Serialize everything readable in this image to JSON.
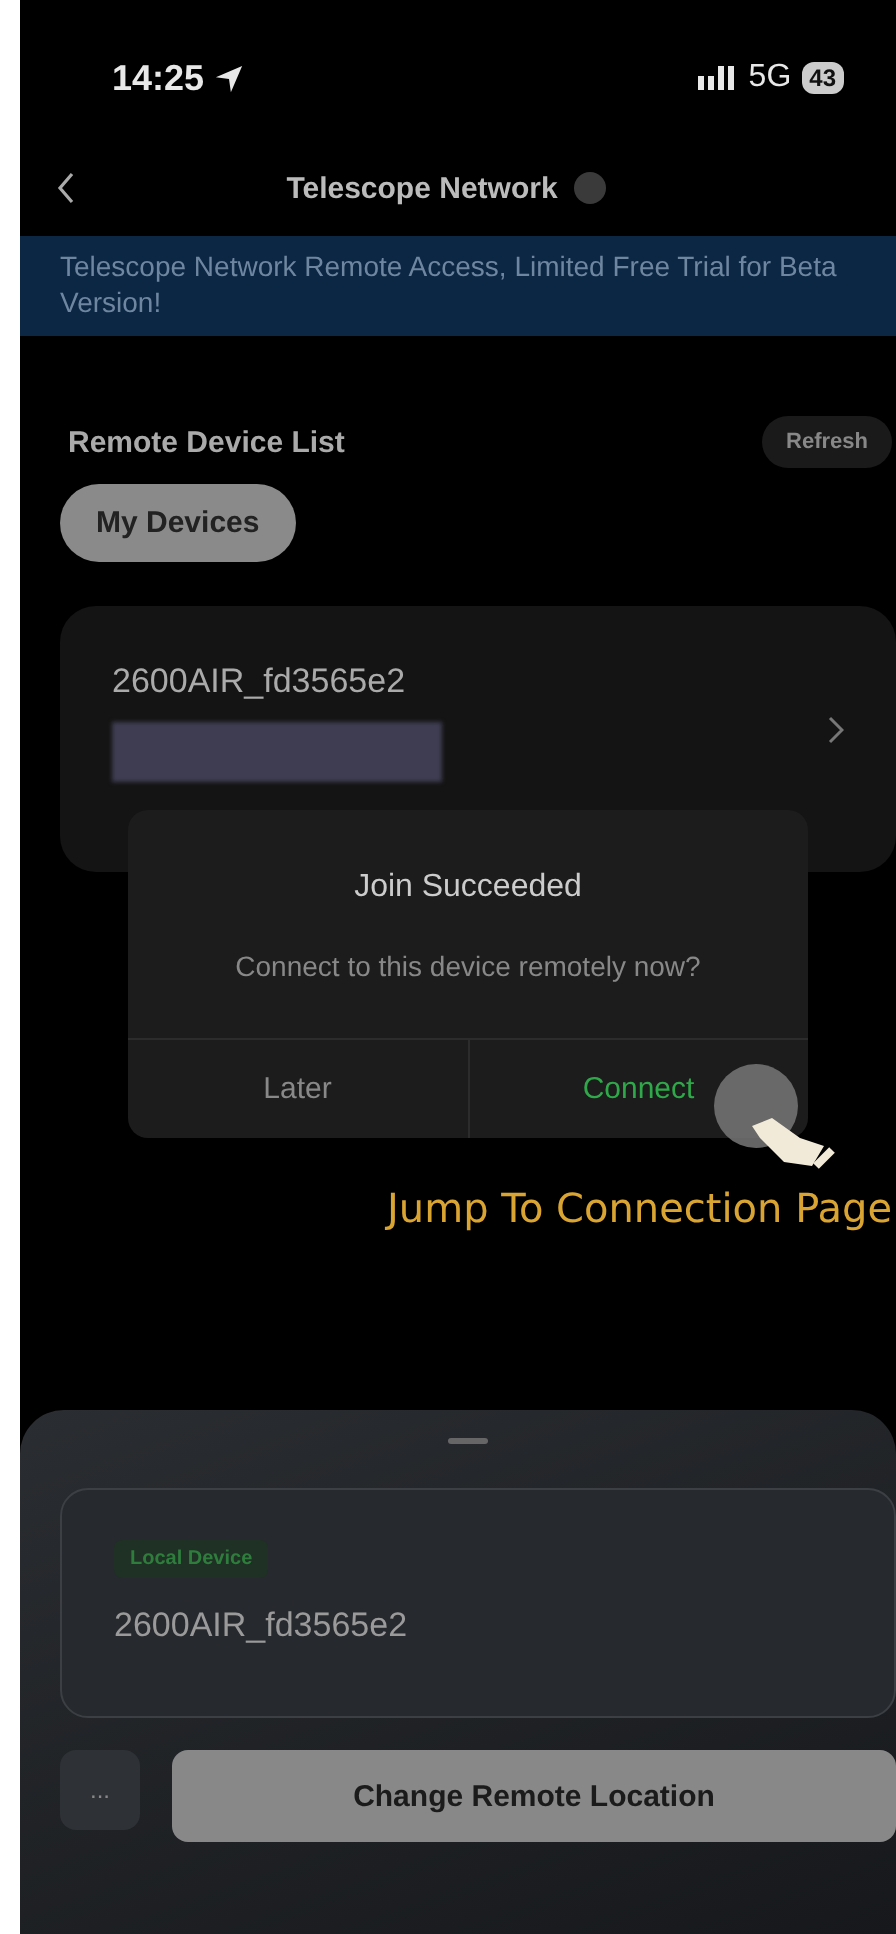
{
  "status_bar": {
    "time": "14:25",
    "network": "5G",
    "battery": "43"
  },
  "nav": {
    "title": "Telescope Network"
  },
  "banner": {
    "text": "Telescope Network Remote Access, Limited Free Trial for Beta Version!"
  },
  "remote_list": {
    "heading": "Remote Device List",
    "refresh": "Refresh",
    "tabs": [
      {
        "label": "My Devices",
        "selected": true
      }
    ],
    "devices": [
      {
        "name": "2600AIR_fd3565e2"
      }
    ]
  },
  "dialog": {
    "title": "Join Succeeded",
    "message": "Connect to this device remotely now?",
    "buttons": [
      {
        "label": "Later",
        "kind": "cancel"
      },
      {
        "label": "Connect",
        "kind": "confirm"
      }
    ]
  },
  "annotation": {
    "text": "Jump To Connection Page"
  },
  "sheet": {
    "local_tag": "Local Device",
    "local_name": "2600AIR_fd3565e2",
    "more": "...",
    "action": "Change Remote Location"
  }
}
